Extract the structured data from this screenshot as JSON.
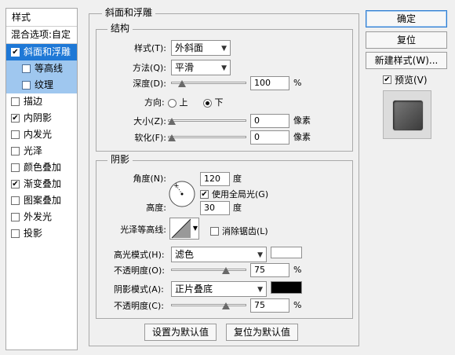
{
  "styles_panel": {
    "header": "样式",
    "blend_options": "混合选项:自定",
    "items": [
      {
        "label": "斜面和浮雕",
        "checked": true,
        "selected": true,
        "sub": false
      },
      {
        "label": "等高线",
        "checked": false,
        "selected": false,
        "sub": true
      },
      {
        "label": "纹理",
        "checked": false,
        "selected": false,
        "sub": true
      },
      {
        "label": "描边",
        "checked": false,
        "selected": false,
        "sub": false
      },
      {
        "label": "内阴影",
        "checked": true,
        "selected": false,
        "sub": false
      },
      {
        "label": "内发光",
        "checked": false,
        "selected": false,
        "sub": false
      },
      {
        "label": "光泽",
        "checked": false,
        "selected": false,
        "sub": false
      },
      {
        "label": "颜色叠加",
        "checked": false,
        "selected": false,
        "sub": false
      },
      {
        "label": "渐变叠加",
        "checked": true,
        "selected": false,
        "sub": false
      },
      {
        "label": "图案叠加",
        "checked": false,
        "selected": false,
        "sub": false
      },
      {
        "label": "外发光",
        "checked": false,
        "selected": false,
        "sub": false
      },
      {
        "label": "投影",
        "checked": false,
        "selected": false,
        "sub": false
      }
    ]
  },
  "bevel": {
    "title": "斜面和浮雕",
    "structure": {
      "title": "结构",
      "style_label": "样式(T):",
      "style_value": "外斜面",
      "technique_label": "方法(Q):",
      "technique_value": "平滑",
      "depth_label": "深度(D):",
      "depth_value": "100",
      "depth_unit": "%",
      "depth_fraction": 0.1,
      "direction_label": "方向:",
      "direction_up": "上",
      "direction_down": "下",
      "direction_selected": "down",
      "size_label": "大小(Z):",
      "size_value": "0",
      "size_unit": "像素",
      "size_fraction": 0.0,
      "soften_label": "软化(F):",
      "soften_value": "0",
      "soften_unit": "像素",
      "soften_fraction": 0.0
    },
    "shading": {
      "title": "阴影",
      "angle_label": "角度(N):",
      "angle_value": "120",
      "angle_unit": "度",
      "global_light_label": "使用全局光(G)",
      "global_light_checked": true,
      "altitude_label": "高度:",
      "altitude_value": "30",
      "altitude_unit": "度",
      "gloss_label": "光泽等高线:",
      "anti_alias_label": "消除锯齿(L)",
      "anti_alias_checked": false,
      "highlight_mode_label": "高光模式(H):",
      "highlight_mode_value": "滤色",
      "highlight_color": "#ffffff",
      "highlight_opacity_label": "不透明度(O):",
      "highlight_opacity_value": "75",
      "highlight_opacity_unit": "%",
      "highlight_opacity_fraction": 0.75,
      "shadow_mode_label": "阴影模式(A):",
      "shadow_mode_value": "正片叠底",
      "shadow_color": "#000000",
      "shadow_opacity_label": "不透明度(C):",
      "shadow_opacity_value": "75",
      "shadow_opacity_unit": "%",
      "shadow_opacity_fraction": 0.75
    },
    "make_default": "设置为默认值",
    "reset_default": "复位为默认值"
  },
  "actions": {
    "ok": "确定",
    "reset": "复位",
    "new_style": "新建样式(W)...",
    "preview_label": "预览(V)",
    "preview_checked": true
  },
  "colors": {
    "selected_bg": "#1e78d6",
    "sub_bg": "#9fc7ef",
    "ok_border": "#2d7cd1"
  },
  "icons": {
    "dropdown": "chevron-down-icon",
    "angle_dial": "angle-dial-icon",
    "contour": "contour-curve-icon",
    "preview": "preview-swatch-icon"
  }
}
